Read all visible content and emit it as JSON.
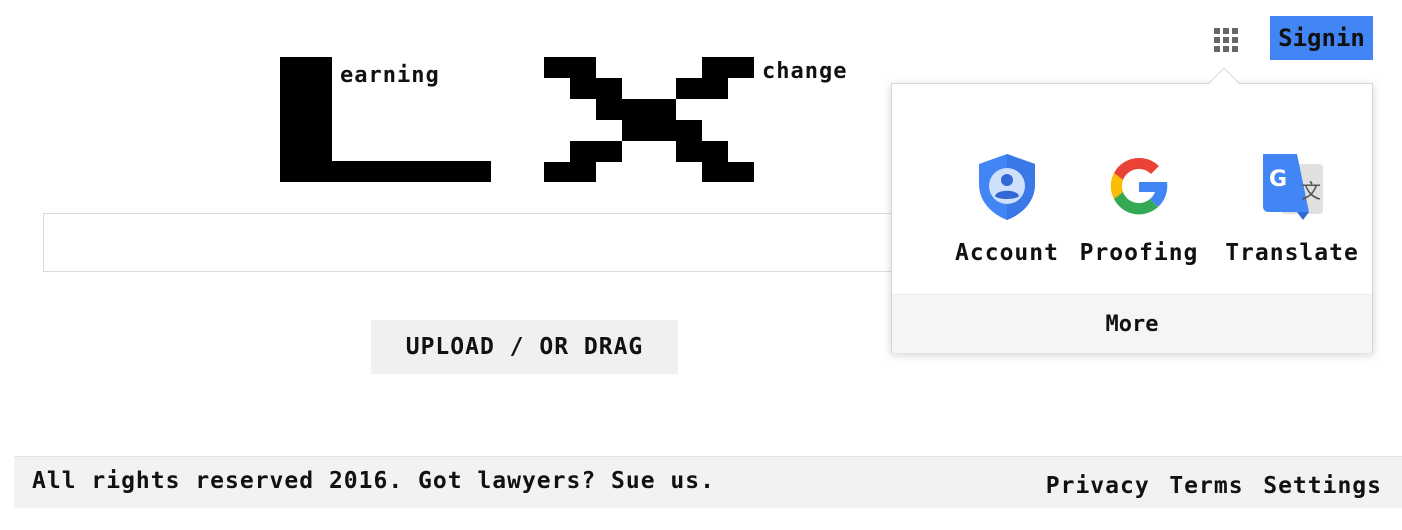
{
  "logo": {
    "word_left": "earning",
    "word_right": "change"
  },
  "search": {
    "value": "",
    "placeholder": ""
  },
  "upload": {
    "label": "UPLOAD / OR DRAG"
  },
  "header": {
    "apps_icon": "apps-grid-icon",
    "signin_label": "Signin"
  },
  "apps_panel": {
    "apps": [
      {
        "label": "Account",
        "icon": "account-shield-icon"
      },
      {
        "label": "Proofing",
        "icon": "google-g-icon"
      },
      {
        "label": "Translate",
        "icon": "translate-icon"
      }
    ],
    "more_label": "More"
  },
  "footer": {
    "copyright": "All rights reserved 2016. Got lawyers? Sue us.",
    "links": [
      "Privacy",
      "Terms",
      "Settings"
    ]
  },
  "colors": {
    "signin_bg": "#4285f4",
    "footer_bg": "#f2f2f2",
    "upload_bg": "#f0f0f0"
  }
}
